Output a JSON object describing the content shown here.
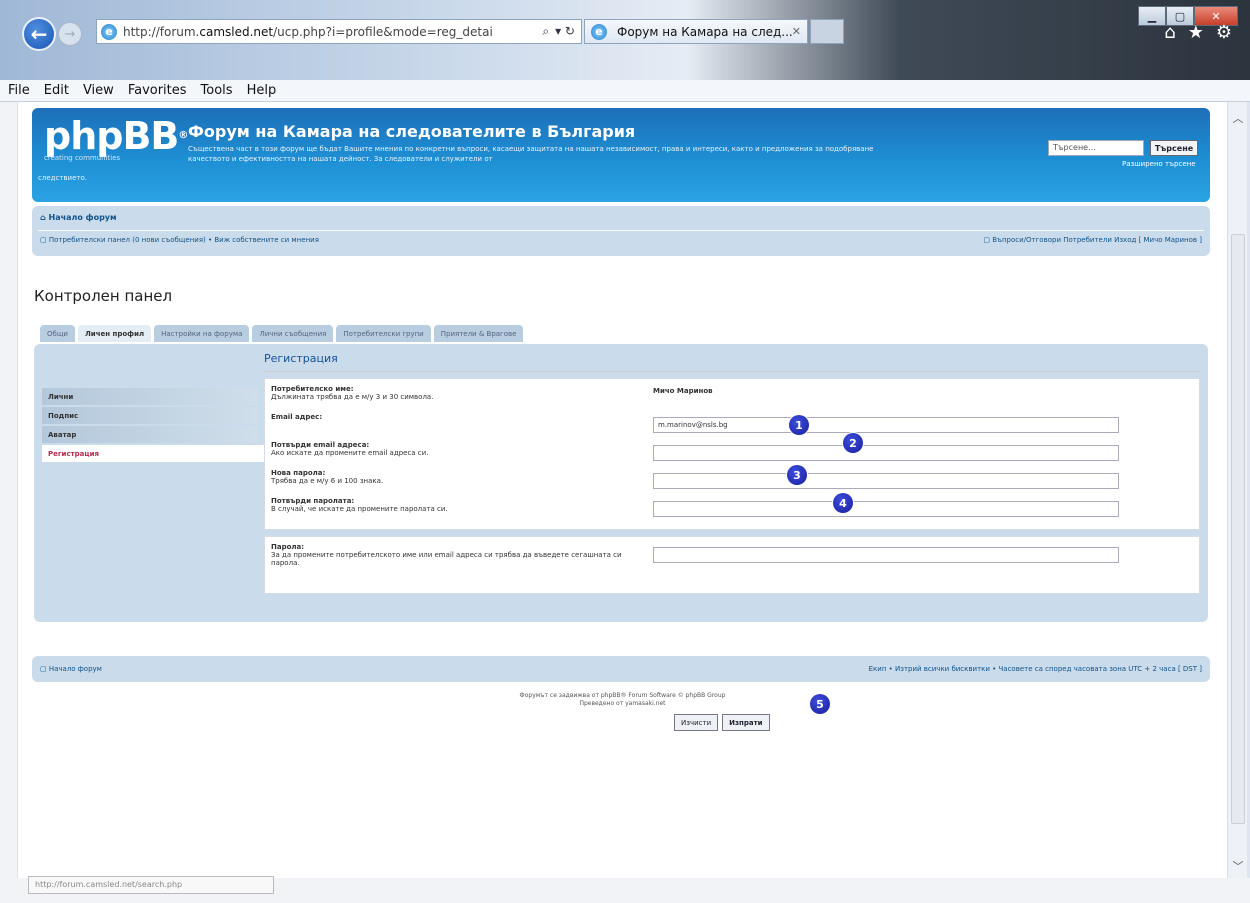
{
  "browser": {
    "url_prefix": "http://forum.",
    "url_domain": "camsled.net",
    "url_rest": "/ucp.php?i=profile&mode=reg_detai",
    "addr_search": "⌕",
    "addr_refresh": "▾ ↻",
    "tab_title": "Форум на Камара на след...",
    "tab_close": "✕",
    "menu": [
      "File",
      "Edit",
      "View",
      "Favorites",
      "Tools",
      "Help"
    ],
    "icons": [
      "home-icon",
      "favorites-star-icon",
      "settings-gear-icon"
    ],
    "status_tip": "http://forum.camsled.net/search.php"
  },
  "header": {
    "logo_text": "phpBB",
    "logo_tagline": "creating communities",
    "title": "Форум на Камара на следователите в България",
    "description": "Съществена част в този форум ще бъдат Вашите мнения по конкретни въпроси, касаещи защитата на нашата независимост, права и интереси, както и предложения за подобряване качеството и ефективността на нашата дейност. За следователи и служители от",
    "description_cont": "следствието.",
    "search_placeholder": "Търсене...",
    "search_button": "Търсене",
    "advanced_search": "Разширено търсене"
  },
  "navbar": {
    "home": "Начало форум",
    "ucp_links": "Потребителски панел (0 нови съобщения) • Виж собствените си мнения",
    "right_links": "Въпроси/Отговори  Потребители  Изход [ Мичо Маринов ]"
  },
  "page_title": "Контролен панел",
  "cp_tabs": [
    "Общи",
    "Личен профил",
    "Настройки на форума",
    "Лични съобщения",
    "Потребителски групи",
    "Приятели & Врагове"
  ],
  "cp_menu": [
    "Лични",
    "Подпис",
    "Аватар",
    "Регистрация"
  ],
  "form": {
    "heading": "Регистрация",
    "fields": [
      {
        "label": "Потребителско име:",
        "hint": "Дължината трябва да е м/у 3 и 30 символа.",
        "value": "Мичо Маринов"
      },
      {
        "label": "Email адрес:",
        "hint": "",
        "value": "m.marinov@nsls.bg"
      },
      {
        "label": "Потвърди email адреса:",
        "hint": "Ако искате да промените email адреса си.",
        "value": ""
      },
      {
        "label": "Нова парола:",
        "hint": "Трябва да е м/у 6 и 100 знака.",
        "value": ""
      },
      {
        "label": "Потвърди паролата:",
        "hint": "В случай, че искате да промените паролата си.",
        "value": ""
      }
    ],
    "password": {
      "label": "Парола:",
      "hint": "За да промените потребителското име или email адреса си трябва да въведете сегашната си парола.",
      "value": ""
    },
    "reset_button": "Изчисти",
    "submit_button": "Изпрати",
    "markers": [
      "1",
      "2",
      "3",
      "4",
      "5"
    ]
  },
  "footer": {
    "home": "Начало форум",
    "right": "Екип • Изтрий всички бисквитки • Часовете са според часовата зона UTC + 2 часа [ DST ]",
    "copyright_1": "Форумът се задвижва от phpBB® Forum Software © phpBB Group",
    "copyright_2": "Преведено от yamasaki.net"
  },
  "colors": {
    "header_blue": "#1e8fd4",
    "panel_blue": "#cadceb",
    "active_menu": "#bc2a4d",
    "marker_blue": "#1a1f9a"
  }
}
